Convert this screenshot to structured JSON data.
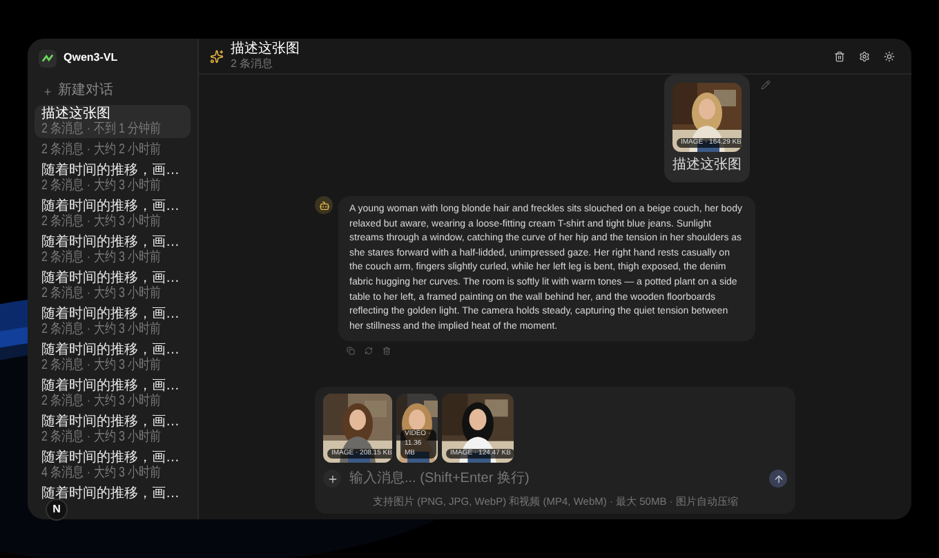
{
  "app": {
    "name": "Qwen3-VL"
  },
  "sidebar": {
    "new_chat": "新建对话",
    "conversations": [
      {
        "title": "描述这张图",
        "meta": "2 条消息 · 不到 1 分钟前",
        "selected": true
      },
      {
        "meta": "2 条消息 · 大约 2 小时前",
        "selected": false
      },
      {
        "title": "随着时间的推移，画…",
        "meta": "2 条消息 · 大约 3 小时前",
        "selected": false
      },
      {
        "title": "随着时间的推移，画…",
        "meta": "2 条消息 · 大约 3 小时前",
        "selected": false
      },
      {
        "title": "随着时间的推移，画…",
        "meta": "2 条消息 · 大约 3 小时前",
        "selected": false
      },
      {
        "title": "随着时间的推移，画…",
        "meta": "2 条消息 · 大约 3 小时前",
        "selected": false
      },
      {
        "title": "随着时间的推移，画…",
        "meta": "2 条消息 · 大约 3 小时前",
        "selected": false
      },
      {
        "title": "随着时间的推移，画…",
        "meta": "2 条消息 · 大约 3 小时前",
        "selected": false
      },
      {
        "title": "随着时间的推移，画…",
        "meta": "2 条消息 · 大约 3 小时前",
        "selected": false
      },
      {
        "title": "随着时间的推移，画…",
        "meta": "2 条消息 · 大约 3 小时前",
        "selected": false
      },
      {
        "title": "随着时间的推移，画…",
        "meta": "4 条消息 · 大约 3 小时前",
        "selected": false
      },
      {
        "title": "随着时间的推移，画…",
        "selected": false
      }
    ]
  },
  "header": {
    "title": "描述这张图",
    "subtitle": "2 条消息"
  },
  "messages": [
    {
      "kind": "user",
      "attachments": [
        {
          "kind": "picture",
          "badge": "IMAGE · 164.29 KB"
        }
      ],
      "text": "描述这张图"
    },
    {
      "kind": "assistant",
      "text": "A young woman with long blonde hair and freckles sits slouched on a beige couch, her body relaxed but aware, wearing a loose-fitting cream T-shirt and tight blue jeans. Sunlight streams through a window, catching the curve of her hip and the tension in her shoulders as she stares forward with a half-lidded, unimpressed gaze. Her right hand rests casually on the couch arm, fingers slightly curled, while her left leg is bent, thigh exposed, the denim fabric hugging her curves. The room is softly lit with warm tones — a potted plant on a side table to her left, a framed painting on the wall behind her, and the wooden floorboards reflecting the golden light. The camera holds steady, capturing the quiet tension between her stillness and the implied heat of the moment."
    }
  ],
  "composer": {
    "attachments": [
      {
        "kind": "picture",
        "badge": "IMAGE · 208.15 KB"
      },
      {
        "kind": "picture",
        "badge": "VIDEO · 11.36 MB"
      },
      {
        "kind": "picture",
        "badge": "IMAGE · 124.47 KB"
      }
    ],
    "placeholder": "输入消息... (Shift+Enter 换行)",
    "hint": "支持图片 (PNG, JPG, WebP) 和视频 (MP4, WebM) · 最大 50MB · 图片自动压缩"
  },
  "dev_badge": "N"
}
